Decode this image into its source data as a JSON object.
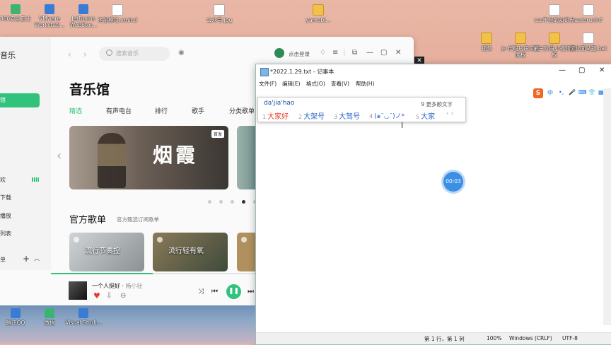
{
  "desktop": {
    "top_icons": [
      {
        "label": "360安全卫士",
        "icon": "shield-icon"
      },
      {
        "label": "VMware Workstati...",
        "icon": "vmware-icon"
      },
      {
        "label": "JetBrains WebStor...",
        "icon": "webstorm-icon"
      },
      {
        "label": "注册模块.xmind",
        "icon": "xmind-file-icon"
      },
      {
        "label": "公众号.jpg",
        "icon": "image-file-icon"
      },
      {
        "label": "yamobi... ",
        "icon": "folder-icon"
      },
      {
        "label": "css不会的知识点",
        "icon": "text-file-icon"
      },
      {
        "label": "autorunlnf",
        "icon": "file-icon"
      }
    ],
    "right_icons": [
      {
        "label": "视频",
        "icon": "folder-icon"
      },
      {
        "label": "js-代码片段实战面板",
        "icon": "folder-icon"
      },
      {
        "label": "第三阶段小视频面板",
        "icon": "folder-icon"
      },
      {
        "label": "优化面试题.bat",
        "icon": "bat-file-icon"
      }
    ],
    "bottom_icons": [
      {
        "label": "腾讯QQ",
        "icon": "qq-icon"
      },
      {
        "label": "微信",
        "icon": "wechat-icon"
      },
      {
        "label": "Visual Studi...",
        "icon": "vscode-icon"
      }
    ]
  },
  "music_app": {
    "brand": "音乐",
    "search_placeholder": "搜索音乐",
    "login": "点击登录",
    "page_title": "音乐馆",
    "sidebar_active": "馆",
    "sidebar_items": [
      "欢",
      "下载",
      "播放",
      "列表",
      "单",
      "单"
    ],
    "tabs": [
      "精选",
      "有声电台",
      "排行",
      "歌手",
      "分类歌单"
    ],
    "banner": {
      "calligraphy": "烟霞",
      "badge": "首发"
    },
    "carousel": {
      "count": 5,
      "active": 3
    },
    "section": {
      "title": "官方歌单",
      "subtitle": "官方甄选订阅歌单"
    },
    "cards": [
      "流行节奏控",
      "流行轻有氧"
    ],
    "player": {
      "song": "一个人挺好",
      "artist": "杨小壮",
      "progress": 0.49
    }
  },
  "notepad": {
    "title": "*2022.1.29.txt - 记事本",
    "menu": [
      "文件(F)",
      "编辑(E)",
      "格式(O)",
      "查看(V)",
      "帮助(H)"
    ],
    "ime": {
      "pinyin": "da'jia'hao",
      "more": "9 更多颜文字",
      "candidates": [
        {
          "n": "1",
          "text": "大家好"
        },
        {
          "n": "2",
          "text": "大架号"
        },
        {
          "n": "3",
          "text": "大驾号"
        },
        {
          "n": "4",
          "text": "(๑ˉ◡ˉ)ノ*"
        },
        {
          "n": "5",
          "text": "大家"
        }
      ],
      "toolbar": [
        "中",
        "•,",
        "🎤",
        "⌨",
        "👕",
        "▦"
      ]
    },
    "status": {
      "position": "第 1 行，第 1 列",
      "zoom": "100%",
      "eol": "Windows (CRLF)",
      "encoding": "UTF-8"
    }
  },
  "timer": "00:03",
  "accent": "#31c27c"
}
